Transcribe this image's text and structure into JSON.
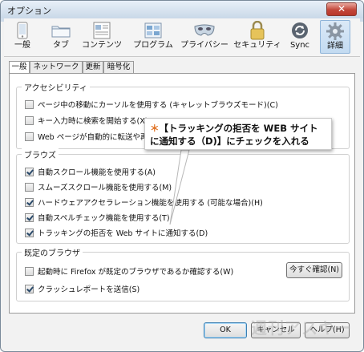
{
  "window": {
    "title": "オプション",
    "close_glyph": "✕"
  },
  "toolbar": {
    "items": [
      {
        "label": "一般",
        "icon": "phone-page-icon"
      },
      {
        "label": "タブ",
        "icon": "folder-tabs-icon"
      },
      {
        "label": "コンテンツ",
        "icon": "content-page-icon"
      },
      {
        "label": "プログラム",
        "icon": "programs-icon"
      },
      {
        "label": "プライバシー",
        "icon": "mask-icon"
      },
      {
        "label": "セキュリティ",
        "icon": "padlock-icon"
      },
      {
        "label": "Sync",
        "icon": "sync-arrows-icon"
      },
      {
        "label": "詳細",
        "icon": "gear-icon"
      }
    ],
    "selected": "詳細"
  },
  "subtabs": {
    "items": [
      "一般",
      "ネットワーク",
      "更新",
      "暗号化"
    ],
    "selected": "一般"
  },
  "accessibility": {
    "title": "アクセシビリティ",
    "items": [
      {
        "label": "ページ中の移動にカーソルを使用する (キャレットブラウズモード)(C)",
        "checked": false
      },
      {
        "label": "キー入力時に検索を開始する(X)",
        "checked": false
      },
      {
        "label": "Web ページが自動的に転送や再",
        "checked": false
      }
    ]
  },
  "browse": {
    "title": "ブラウズ",
    "items": [
      {
        "label": "自動スクロール機能を使用する(A)",
        "checked": true
      },
      {
        "label": "スムーズスクロール機能を使用する(M)",
        "checked": false
      },
      {
        "label": "ハードウェアアクセラレーション機能を使用する (可能な場合)(H)",
        "checked": true
      },
      {
        "label": "自動スペルチェック機能を使用する(T)",
        "checked": true
      },
      {
        "label": "トラッキングの拒否を Web サイトに通知する(D)",
        "checked": true
      }
    ]
  },
  "default_browser": {
    "title": "既定のブラウザ",
    "items": [
      {
        "label": "起動時に Firefox が既定のブラウザであるか確認する(W)",
        "checked": false
      },
      {
        "label": "クラッシュレポートを送信(S)",
        "checked": true
      }
    ],
    "check_now": "今すぐ確認(N)"
  },
  "callout": {
    "mark": "＊",
    "line1": "【トラッキングの拒否を WEB サイト",
    "line2": "に通知する（D)】にチェックを入れる"
  },
  "buttons": {
    "ok": "OK",
    "cancel": "キャンセル",
    "help": "ヘルプ(H)"
  },
  "watermark": "週刊アスキー",
  "colors": {
    "accent_orange": "#e07020",
    "selected_tab": "#c3dbf1",
    "close_red": "#c3473a"
  }
}
